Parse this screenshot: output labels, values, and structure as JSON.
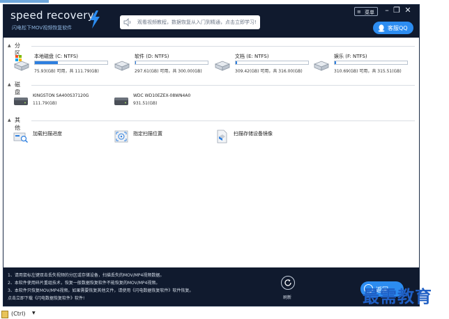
{
  "app": {
    "logo_text": "speed recovery",
    "logo_subtitle": "闪电松下MOV视频恢复软件",
    "notice_text": "观看视频教程，数据恢复从入门到精通，点击立即学习!",
    "menu_label": "菜单",
    "window_controls": {
      "minimize": "–",
      "restore": "❐",
      "close": "✕"
    },
    "service_label": "客服QQ"
  },
  "sections": {
    "partitions_title": "分区",
    "disks_title": "磁盘",
    "others_title": "其他"
  },
  "partitions": [
    {
      "name": "本地磁盘 (C: NTFS)",
      "capacity": "75.93(GB) 可用，共 111.79(GB)",
      "used_fraction": 0.32
    },
    {
      "name": "软件 (D: NTFS)",
      "capacity": "297.61(GB) 可用，共 300.00(GB)",
      "used_fraction": 0.01
    },
    {
      "name": "文档 (E: NTFS)",
      "capacity": "309.42(GB) 可用，共 316.00(GB)",
      "used_fraction": 0.02
    },
    {
      "name": "娱乐 (F: NTFS)",
      "capacity": "310.69(GB) 可用，共 315.51(GB)",
      "used_fraction": 0.015
    }
  ],
  "disks": [
    {
      "name": "KINGSTON SA400S37120G",
      "capacity": "111.79(GB)"
    },
    {
      "name": "WDC WD10EZEX-08WN4A0",
      "capacity": "931.51(GB)"
    }
  ],
  "others": [
    {
      "name": "加载扫描进度",
      "icon": "load-scan-icon"
    },
    {
      "name": "指定扫描位置",
      "icon": "target-scan-icon"
    },
    {
      "name": "扫描存储设备镜像",
      "icon": "disk-image-icon"
    }
  ],
  "footer": {
    "notes": [
      "1、请用鼠标左键双击丢失视频的分区或存储设备，扫描丢失的MOV/MP4视频数据。",
      "2、本软件使用碎片重组技术，恢复一般数据恢复软件不能恢复的MOV/MP4视频。",
      "3、本软件只恢复MOV/MP4视频。如果需要恢复其他文件，请使用《闪电数据恢复软件》软件恢复。",
      "   点击立即下载《闪电数据恢复软件》软件!"
    ],
    "refresh_label": "刷新",
    "back_label": "返回"
  },
  "watermark": "最需教育",
  "paste_label": "(Ctrl)",
  "colors": {
    "titlebar": "#101a2e",
    "accent_blue": "#2c8cf0",
    "progress_fill": "#2d7fe0",
    "watermark": "#1f5fc4"
  }
}
